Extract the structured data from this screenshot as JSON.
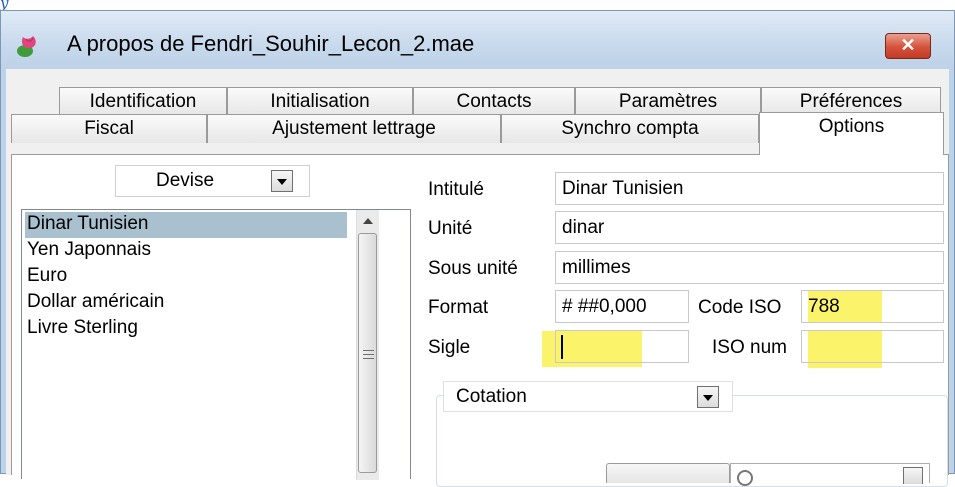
{
  "window": {
    "title": "A propos de Fendri_Souhir_Lecon_2.mae",
    "close_glyph": "✕",
    "accent": "#c13b24"
  },
  "tabs": {
    "row1": [
      "Identification",
      "Initialisation",
      "Contacts",
      "Paramètres",
      "Préférences"
    ],
    "row2": [
      "Fiscal",
      "Ajustement lettrage",
      "Synchro compta",
      "Options"
    ],
    "active": "Options"
  },
  "devise": {
    "selected": "Devise",
    "items": [
      "Dinar Tunisien",
      "Yen Japonnais",
      "Euro",
      "Dollar américain",
      "Livre Sterling"
    ],
    "selected_item": "Dinar Tunisien"
  },
  "form": {
    "intitule_label": "Intitulé",
    "intitule_value": "Dinar Tunisien",
    "unite_label": "Unité",
    "unite_value": "dinar",
    "sous_unite_label": "Sous unité",
    "sous_unite_value": "millimes",
    "format_label": "Format",
    "format_value": "# ##0,000",
    "code_iso_label": "Code ISO",
    "code_iso_value": "788",
    "sigle_label": "Sigle",
    "sigle_value": "",
    "iso_num_label": "ISO num",
    "iso_num_value": ""
  },
  "cotation": {
    "selected": "Cotation"
  },
  "highlight_color": "#fbf46b"
}
